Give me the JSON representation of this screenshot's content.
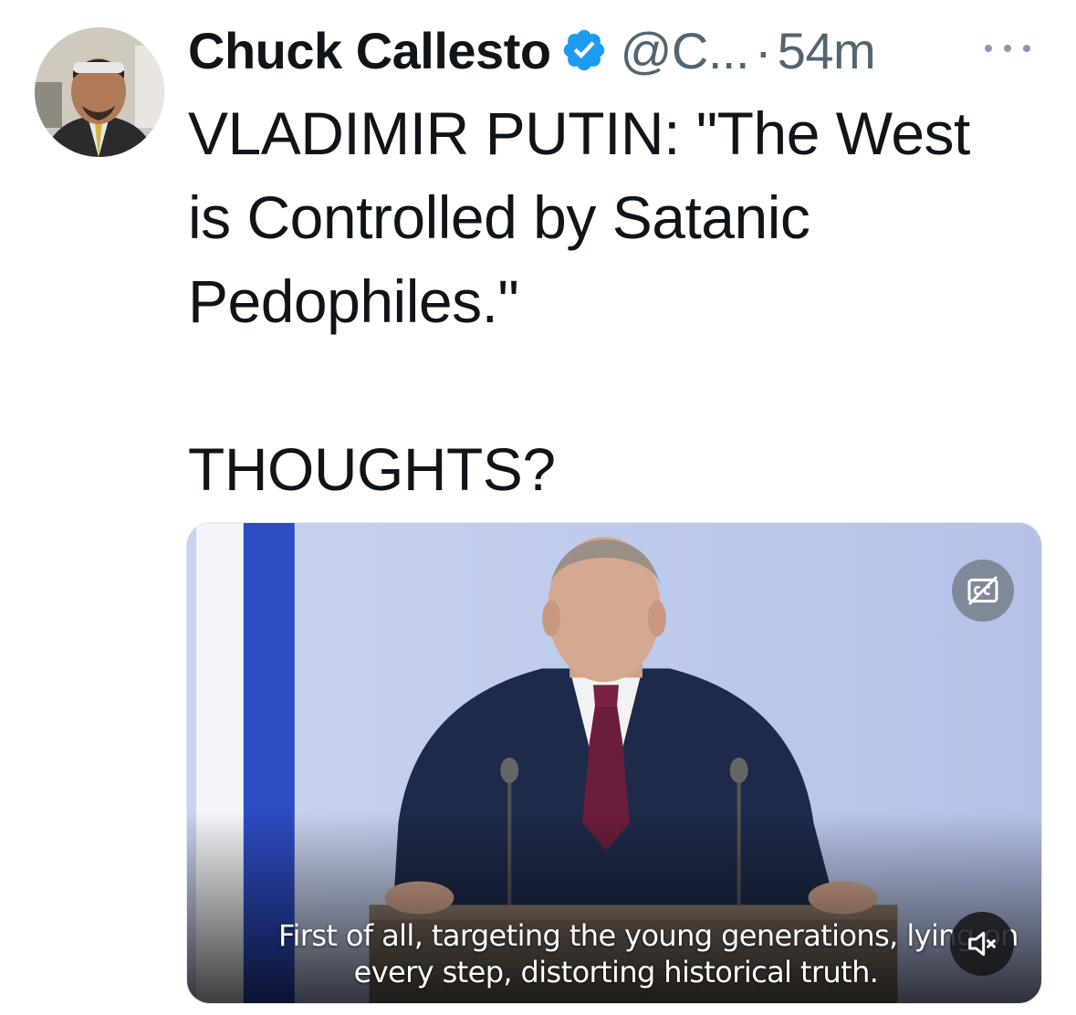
{
  "author": {
    "display_name": "Chuck Callesto",
    "handle": "@C...",
    "separator": "·",
    "timestamp": "54m",
    "verified_badge_color": "#1d9bf0"
  },
  "tweet": {
    "text_lines": [
      "VLADIMIR PUTIN: \"The West",
      "is Controlled by Satanic",
      "Pedophiles.\""
    ],
    "closing_line": "THOUGHTS?"
  },
  "media": {
    "type": "video",
    "subtitle_lines": [
      "First of all, targeting the young generations, lying on",
      "every step, distorting historical truth."
    ],
    "captions_icon": "closed-captions-off-icon",
    "mute_icon": "speaker-muted-icon"
  },
  "colors": {
    "text_primary": "#0f1419",
    "text_secondary": "#536471",
    "accent": "#1d9bf0"
  }
}
